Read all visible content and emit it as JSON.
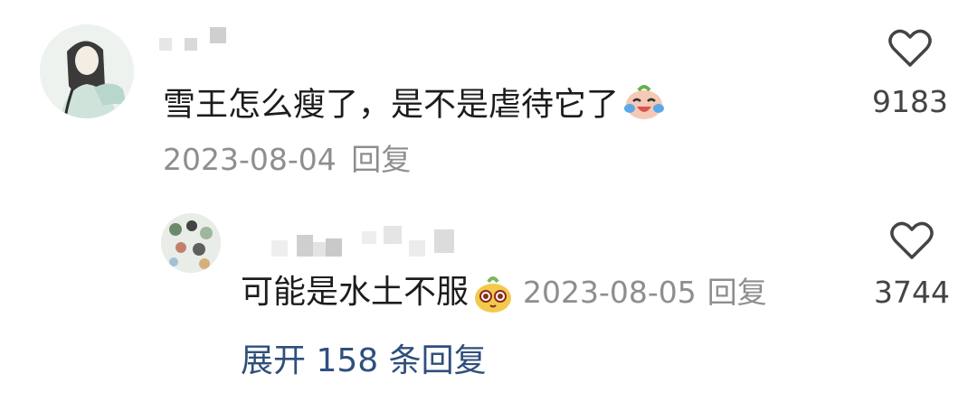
{
  "comments": [
    {
      "text": "雪王怎么瘦了，是不是虐待它了",
      "emoji": "laugh-cry-emoji",
      "date": "2023-08-04",
      "reply_label": "回复",
      "likes": "9183",
      "avatar": "illustrated-character-avatar"
    },
    {
      "text": "可能是水土不服",
      "emoji": "yellow-mascot-emoji",
      "date": "2023-08-05",
      "reply_label": "回复",
      "likes": "3744",
      "avatar": "collage-avatar"
    }
  ],
  "expand_replies": "展开 158 条回复",
  "colors": {
    "expand": "#2f4f7d",
    "meta": "#8e8e8e",
    "text": "#1c1c1c"
  }
}
